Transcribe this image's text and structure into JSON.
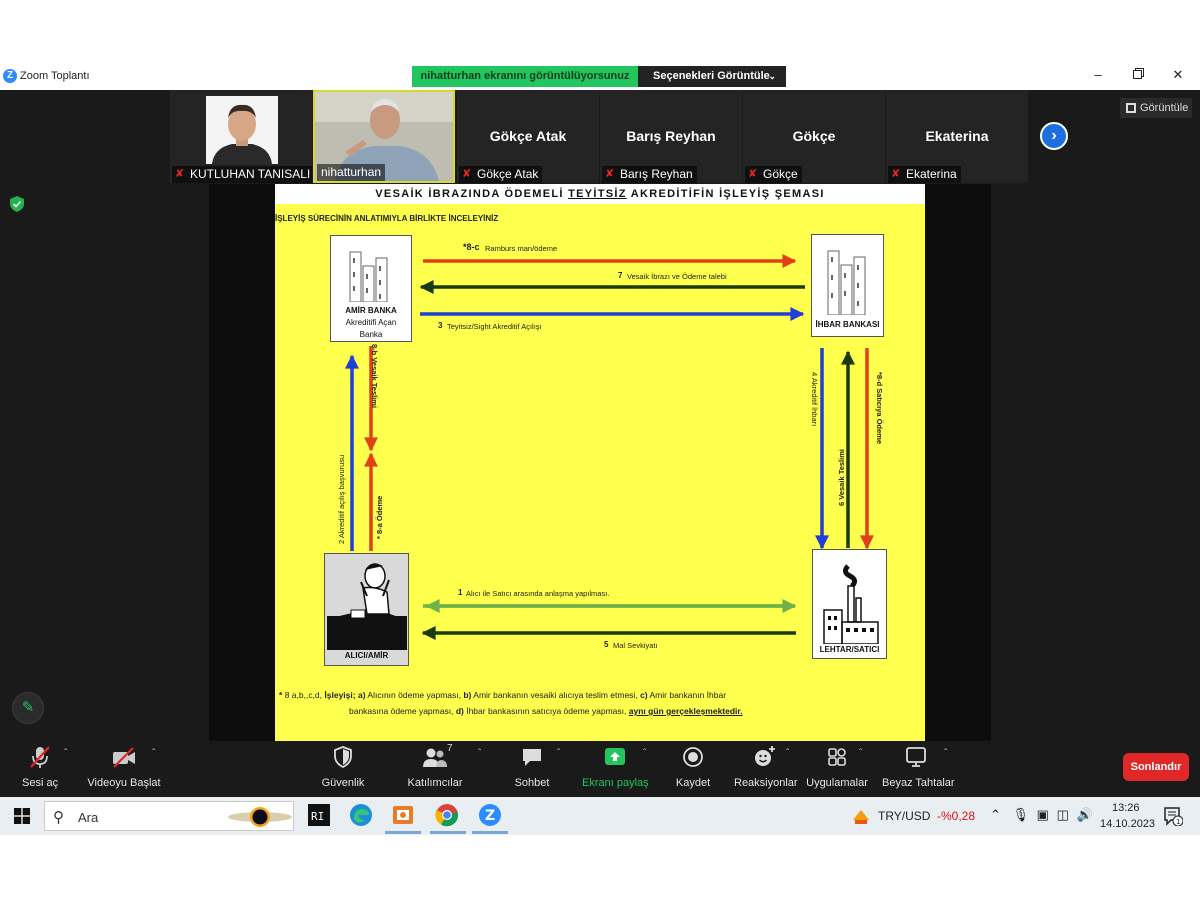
{
  "window": {
    "title": "Zoom Toplantı",
    "share_banner": "nihatturhan ekranını görüntülüyorsunuz",
    "view_options": "Seçenekleri Görüntüle",
    "view_button": "Görüntüle"
  },
  "gallery": {
    "participants": [
      {
        "label": "KUTLUHAN TANISALI",
        "muted": true,
        "video": true
      },
      {
        "label": "nihatturhan",
        "muted": false,
        "video": true,
        "active_speaker": true
      },
      {
        "name": "Gökçe Atak",
        "label": "Gökçe Atak",
        "muted": true,
        "video": false
      },
      {
        "name": "Barış Reyhan",
        "label": "Barış Reyhan",
        "muted": true,
        "video": false
      },
      {
        "name": "Gökçe",
        "label": "Gökçe",
        "muted": true,
        "video": false
      },
      {
        "name": "Ekaterina",
        "label": "Ekaterina",
        "muted": true,
        "video": false
      }
    ]
  },
  "slide": {
    "title_pre": "VESAİK İBRAZINDA ÖDEMELİ ",
    "title_underlined": "TEYİTSİZ",
    "title_post": " AKREDİTİFİN İŞLEYİŞ ŞEMASI",
    "subtitle": "İŞLEYİŞ SÜRECİNİN ANLATIMIYLA BİRLİKTE İNCELEYİNİZ",
    "amir_banka": {
      "line1": "AMİR BANKA",
      "line2": "Akreditifi Açan",
      "line3": "Banka"
    },
    "ihbar_bankasi": "İHBAR BANKASI",
    "alici": "ALICI/AMİR",
    "lehtar": "LEHTAR/SATICI",
    "steps": {
      "s8c_num": "*8-c",
      "s8c": "Ramburs man/ödeme",
      "s7_num": "7",
      "s7": "Vesaik İbrazı ve Ödeme talebi",
      "s3_num": "3",
      "s3": "Teyitsiz/Sight Akreditif Açılışı",
      "s8b": "8-b Vesaik Teslimi",
      "s2": "2 Akreditif açılış başvurusu",
      "s8a": "* 8-a Ödeme",
      "s4": "4 Akreditif İhbarı",
      "s6": "6 Vesaik Teslimi",
      "s8d": "*8-d Satıcıya Ödeme",
      "s1_num": "1",
      "s1": "Alıcı ile Satıcı arasında anlaşma yapılması.",
      "s5_num": "5",
      "s5": "Mal Sevkiyatı"
    },
    "note": {
      "star": "*",
      "prefix": "8 a,b,,c,d,",
      "head": "İşleyişi;",
      "a": "a)",
      "a_text": " Alıcının ödeme yapması,",
      "b": "b)",
      "b_text": " Amir bankanın vesaiki alıcıya teslim etmesi,",
      "c": "c)",
      "c_text": " Amir bankanın İhbar",
      "line2": "bankasına ödeme yapması,",
      "d": "d)",
      "d_text": " İhbar bankasının satıcıya ödeme yapması,",
      "emph": "aynı gün gerçekleşmektedir."
    },
    "colors": {
      "background": "#ffff4d",
      "red": "#e0401a",
      "dark_green": "#1a3a12",
      "blue": "#1f3fd6",
      "light_green": "#6fb14a"
    }
  },
  "toolbar": {
    "mute": "Sesi aç",
    "video": "Videoyu Başlat",
    "security": "Güvenlik",
    "participants": "Katılımcılar",
    "participants_count": "7",
    "chat": "Sohbet",
    "share": "Ekranı paylaş",
    "record": "Kaydet",
    "reactions": "Reaksiyonlar",
    "apps": "Uygulamalar",
    "whiteboards": "Beyaz Tahtalar",
    "end": "Sonlandır"
  },
  "taskbar": {
    "search_placeholder": "Ara",
    "currency_pair": "TRY/USD",
    "currency_change": "-%0,28",
    "time": "13:26",
    "date": "14.10.2023",
    "notification_count": "1"
  }
}
